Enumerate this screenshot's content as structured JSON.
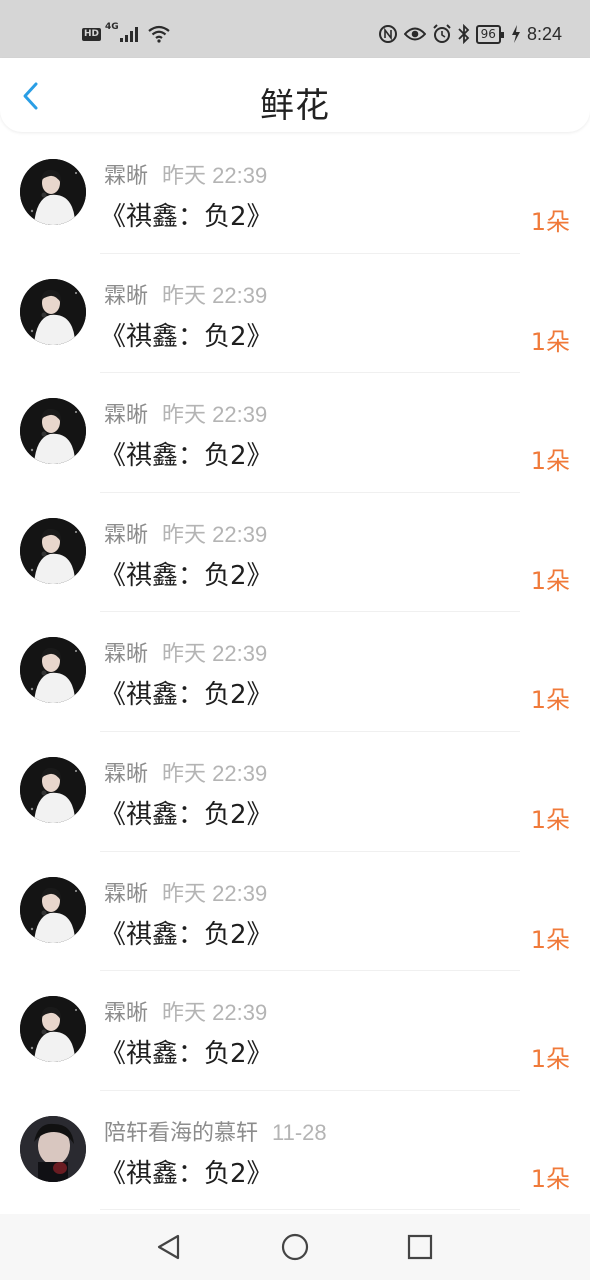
{
  "status_bar": {
    "hd": "HD",
    "network": "4G",
    "battery": "96",
    "time": "8:24",
    "icons": [
      "hd-icon",
      "signal-icon",
      "wifi-icon",
      "nfc-icon",
      "eye-icon",
      "alarm-icon",
      "bluetooth-icon",
      "battery-icon",
      "charging-icon"
    ]
  },
  "header": {
    "title": "鲜花",
    "back_icon": "chevron-left-icon",
    "accent": "#2a9ee5"
  },
  "colors": {
    "count": "#f07a3a",
    "meta": "#b4b4b4"
  },
  "items": [
    {
      "sender": "霖晰",
      "time": "昨天 22:39",
      "song": "《祺鑫：负2》",
      "count": "1朵",
      "avatar": "avatar-white"
    },
    {
      "sender": "霖晰",
      "time": "昨天 22:39",
      "song": "《祺鑫：负2》",
      "count": "1朵",
      "avatar": "avatar-white"
    },
    {
      "sender": "霖晰",
      "time": "昨天 22:39",
      "song": "《祺鑫：负2》",
      "count": "1朵",
      "avatar": "avatar-white"
    },
    {
      "sender": "霖晰",
      "time": "昨天 22:39",
      "song": "《祺鑫：负2》",
      "count": "1朵",
      "avatar": "avatar-white"
    },
    {
      "sender": "霖晰",
      "time": "昨天 22:39",
      "song": "《祺鑫：负2》",
      "count": "1朵",
      "avatar": "avatar-white"
    },
    {
      "sender": "霖晰",
      "time": "昨天 22:39",
      "song": "《祺鑫：负2》",
      "count": "1朵",
      "avatar": "avatar-white"
    },
    {
      "sender": "霖晰",
      "time": "昨天 22:39",
      "song": "《祺鑫：负2》",
      "count": "1朵",
      "avatar": "avatar-white"
    },
    {
      "sender": "霖晰",
      "time": "昨天 22:39",
      "song": "《祺鑫：负2》",
      "count": "1朵",
      "avatar": "avatar-white"
    },
    {
      "sender": "陪轩看海的慕轩",
      "time": "11-28",
      "song": "《祺鑫：负2》",
      "count": "1朵",
      "avatar": "avatar-dark"
    }
  ],
  "nav_bar": {
    "icons": [
      "back-triangle-icon",
      "home-circle-icon",
      "recents-square-icon"
    ]
  }
}
